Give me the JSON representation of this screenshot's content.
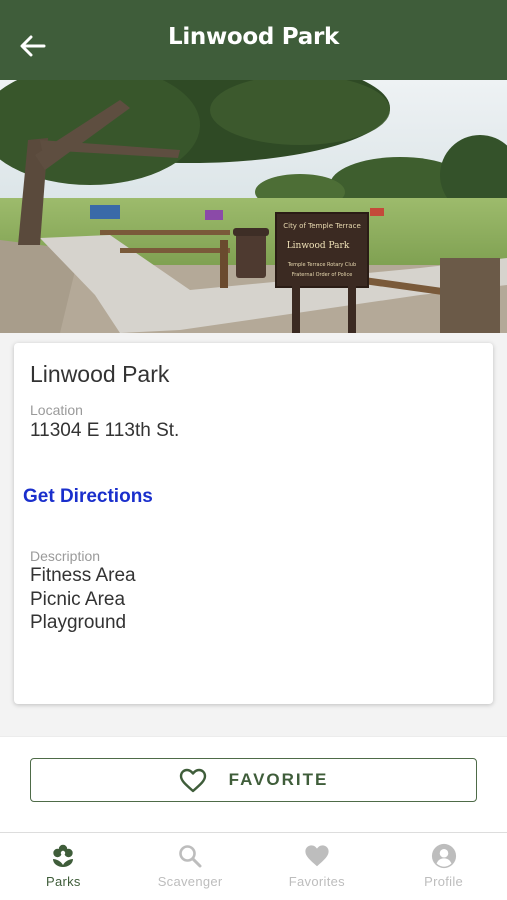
{
  "header": {
    "title": "Linwood Park",
    "back_icon": "arrow-left-icon"
  },
  "hero": {
    "sign_lines": [
      "City of Temple Terrace",
      "Linwood Park",
      "Temple Terrace Rotary Club",
      "Fraternal Order of Police"
    ]
  },
  "park": {
    "name": "Linwood Park",
    "location_label": "Location",
    "location_value": "11304 E 113th St.",
    "directions_label": "Get Directions",
    "description_label": "Description",
    "amenities": [
      "Fitness Area",
      "Picnic Area",
      "Playground"
    ]
  },
  "favorite": {
    "label": "FAVORITE",
    "icon": "heart-outline-icon"
  },
  "tabs": [
    {
      "label": "Parks",
      "icon": "flower-icon",
      "active": true
    },
    {
      "label": "Scavenger",
      "icon": "search-icon",
      "active": false
    },
    {
      "label": "Favorites",
      "icon": "heart-icon",
      "active": false
    },
    {
      "label": "Profile",
      "icon": "profile-icon",
      "active": false
    }
  ],
  "colors": {
    "brand": "#3f5d3a",
    "link": "#1a2fcc",
    "inactive_tab": "#bdbdbd"
  }
}
